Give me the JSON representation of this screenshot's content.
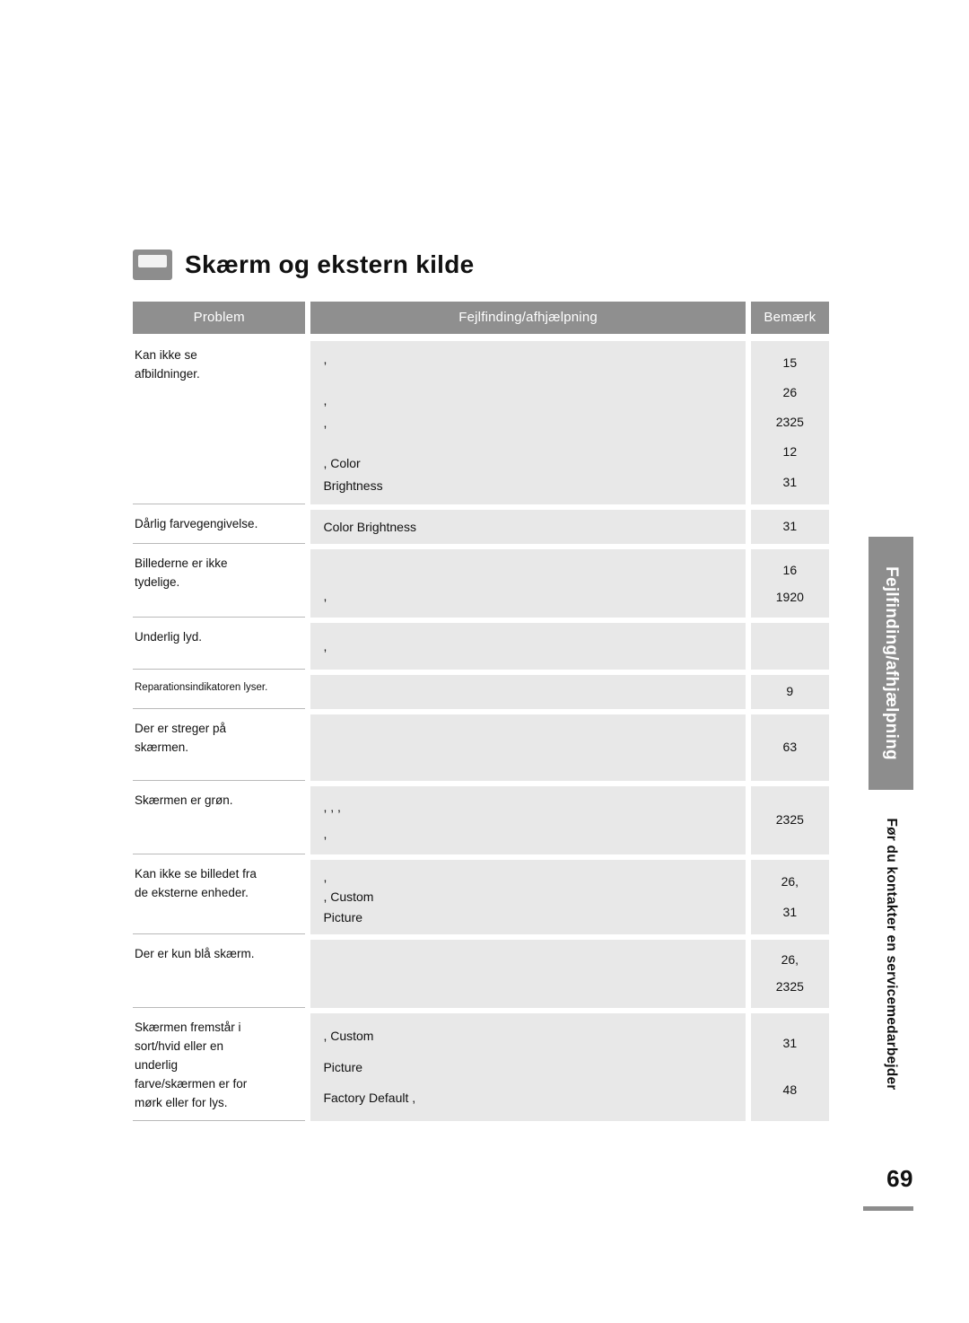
{
  "page": {
    "title": "Skærm og ekstern kilde",
    "number": "69",
    "side_tab_primary": "Fejlfinding/afhjælpning",
    "side_tab_secondary": "Før du kontakter en servicemedarbejder"
  },
  "table": {
    "headers": {
      "problem": "Problem",
      "solution": "Fejlfinding/afhjælpning",
      "note": "Bemærk"
    },
    "rows": [
      {
        "problem": "Kan ikke se\nafbildninger.",
        "problem_lines": [
          "Kan ikke se",
          "afbildninger."
        ],
        "solution_lines": [
          ",",
          "",
          ",",
          ",",
          "",
          ",                                        Color",
          "Brightness"
        ],
        "note_lines": [
          "15",
          "26",
          "2325",
          "12",
          "31"
        ]
      },
      {
        "problem_lines": [
          "Dårlig farvegengivelse."
        ],
        "solution_lines": [
          "      Color                Brightness"
        ],
        "note_lines": [
          "31"
        ]
      },
      {
        "problem_lines": [
          "Billederne er ikke",
          "tydelige."
        ],
        "solution_lines": [
          "",
          ","
        ],
        "note_lines": [
          "16",
          "1920"
        ]
      },
      {
        "problem_lines": [
          "Underlig lyd."
        ],
        "solution_lines": [
          ","
        ],
        "note_lines": [
          ""
        ]
      },
      {
        "problem_lines": [
          "Reparationsindikatoren lyser."
        ],
        "problem_small": true,
        "solution_lines": [
          ""
        ],
        "note_lines": [
          "9"
        ]
      },
      {
        "problem_lines": [
          "Der er streger på",
          "skærmen."
        ],
        "solution_lines": [
          ""
        ],
        "note_lines": [
          "63"
        ]
      },
      {
        "problem_lines": [
          "Skærmen er grøn."
        ],
        "solution_lines": [
          ",        , ,",
          "  ,"
        ],
        "note_lines": [
          "2325"
        ]
      },
      {
        "problem_lines": [
          "Kan ikke se billedet fra",
          "de eksterne enheder."
        ],
        "solution_lines": [
          ",",
          ",                                   Custom",
          "Picture"
        ],
        "note_lines": [
          "26,",
          "31"
        ]
      },
      {
        "problem_lines": [
          "Der er kun blå skærm."
        ],
        "solution_lines": [
          ""
        ],
        "note_lines": [
          "26,",
          "2325"
        ]
      },
      {
        "problem_lines": [
          "Skærmen fremstår i",
          "sort/hvid eller en",
          "underlig",
          "farve/skærmen er for",
          "mørk eller for lys."
        ],
        "solution_lines": [
          ",                                  Custom",
          "Picture",
          "      Factory Default        ,"
        ],
        "note_lines": [
          "31",
          "48"
        ]
      }
    ]
  }
}
